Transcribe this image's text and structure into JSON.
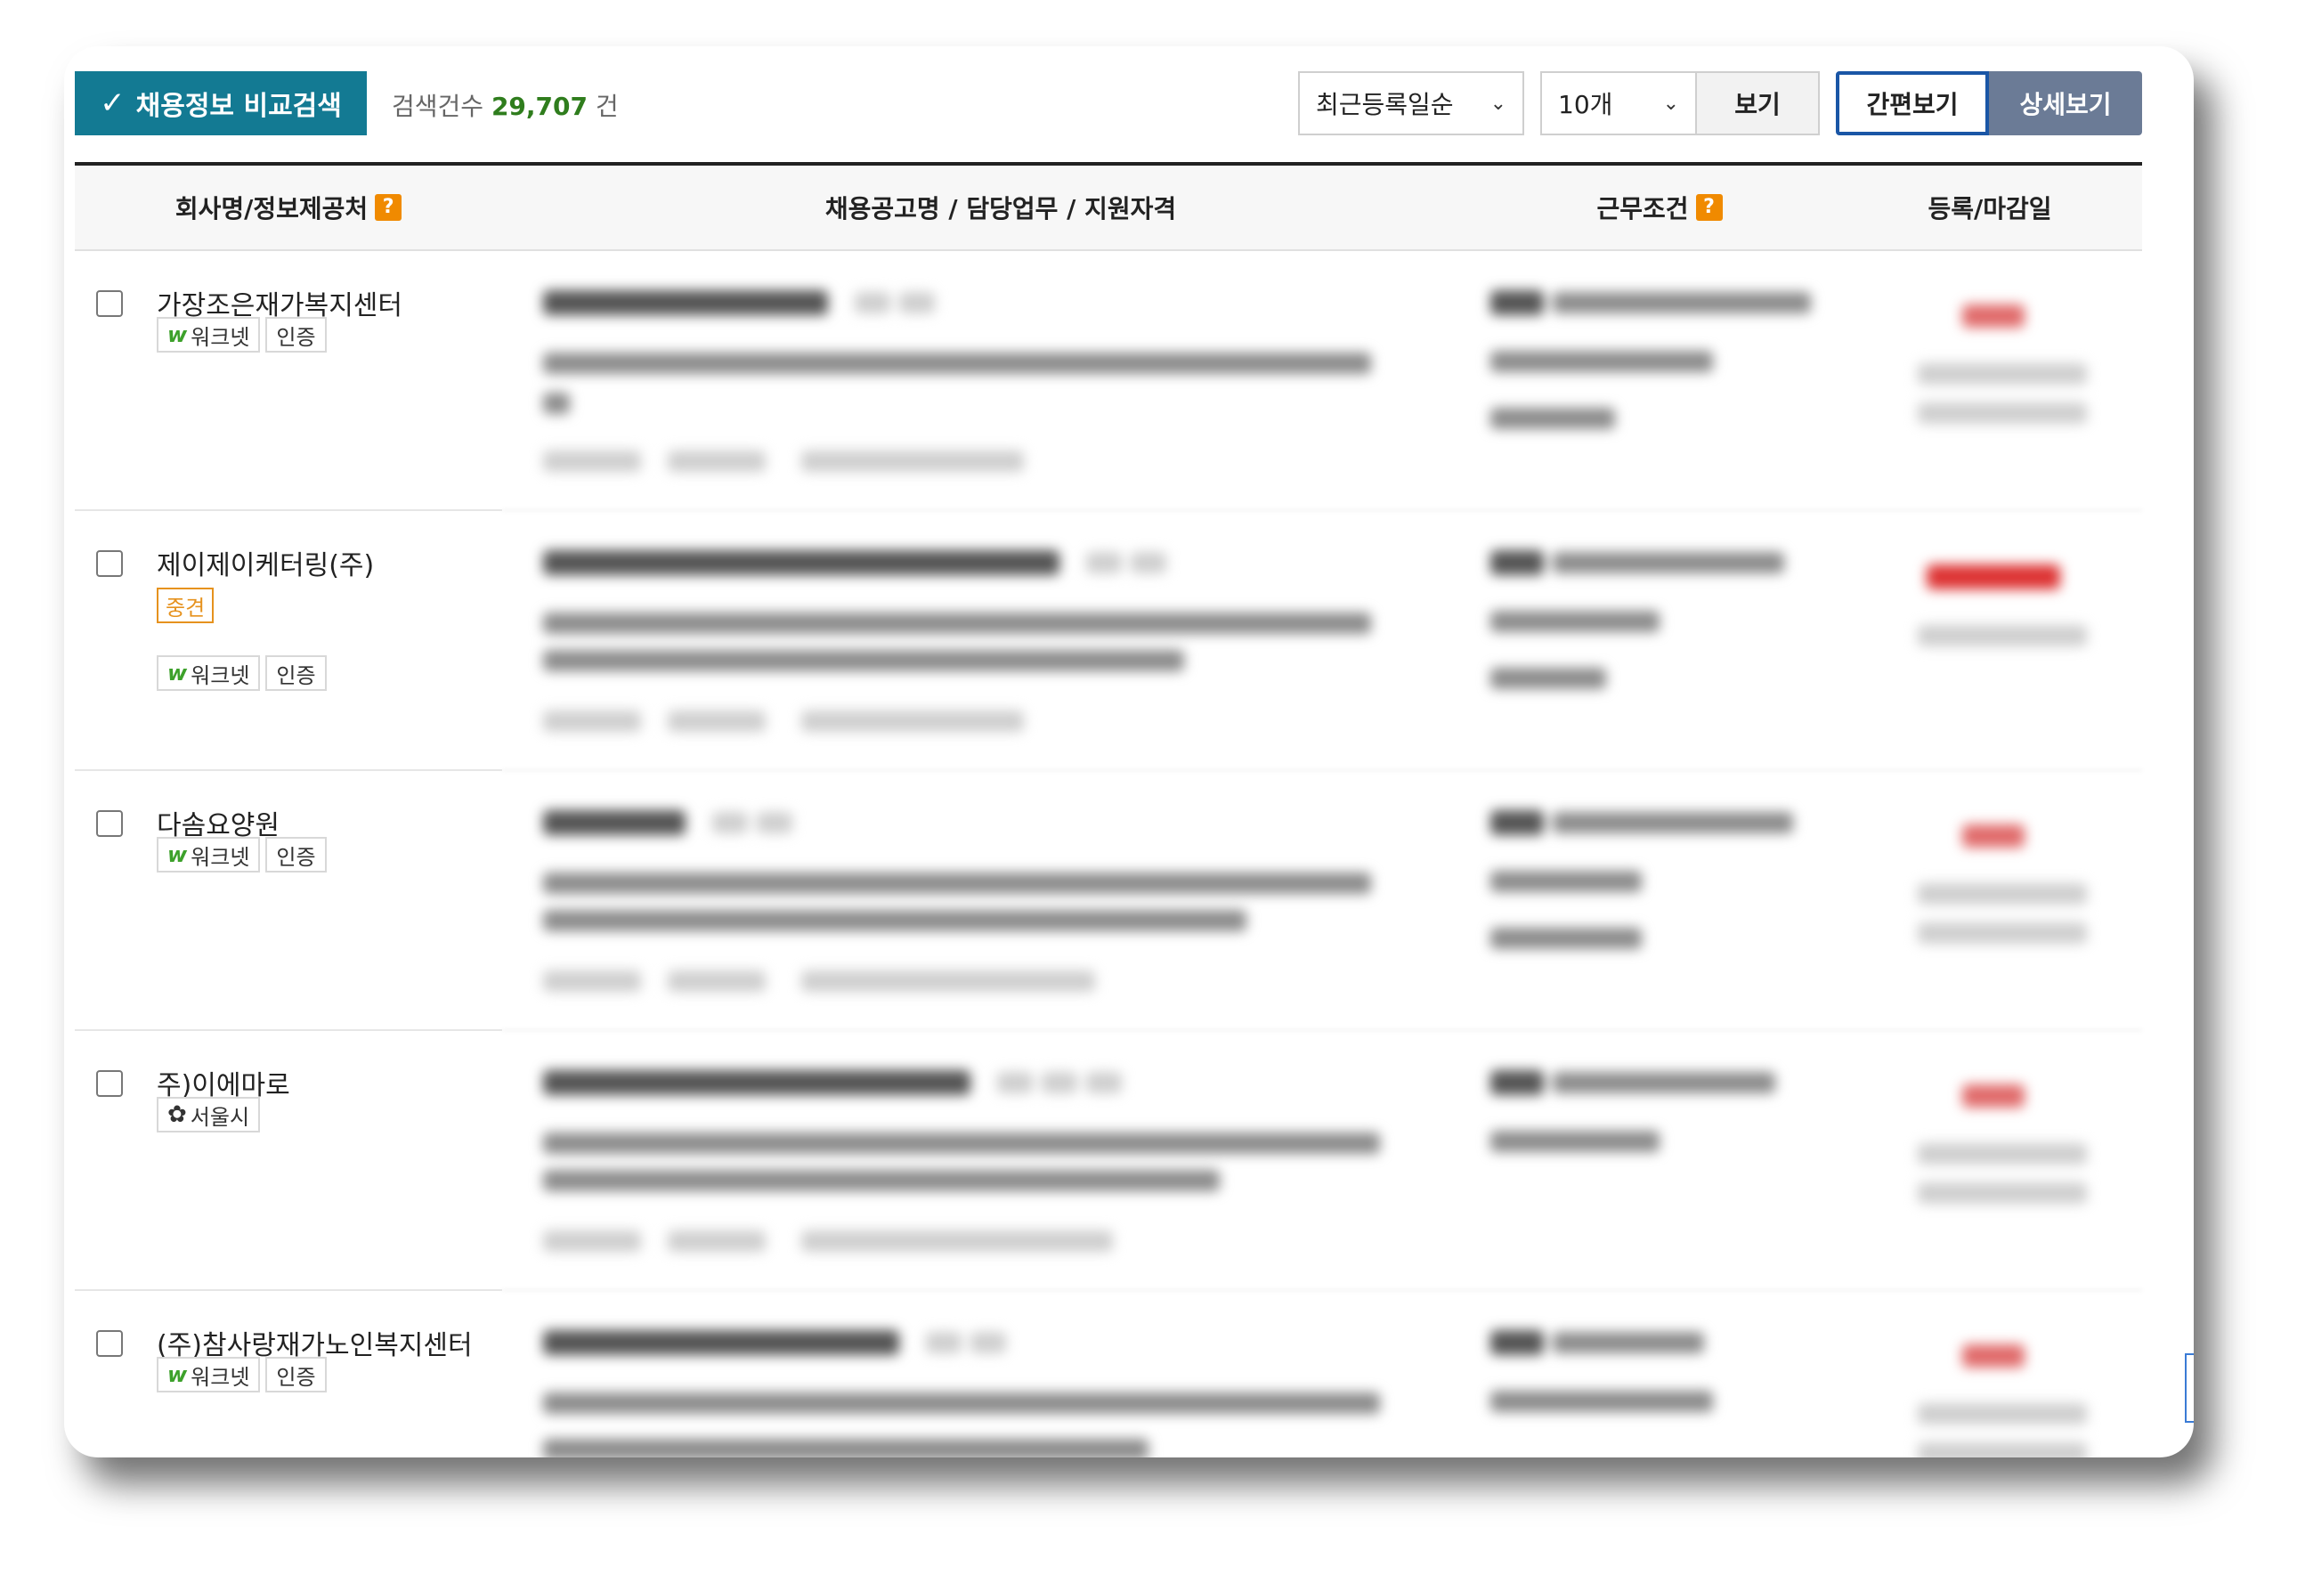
{
  "toolbar": {
    "compare_label": "채용정보 비교검색",
    "count_prefix": "검색건수",
    "count_value": "29,707",
    "count_suffix": "건",
    "sort_selected": "최근등록일순",
    "page_size_selected": "10개",
    "view_label": "보기",
    "simple_view_label": "간편보기",
    "detail_view_label": "상세보기"
  },
  "table": {
    "headers": {
      "company": "회사명/정보제공처",
      "posting": "채용공고명 / 담당업무 / 지원자격",
      "conditions": "근무조건",
      "dates": "등록/마감일"
    },
    "help_mark": "?"
  },
  "rows": [
    {
      "company": "가장조은재가복지센터",
      "tag": "",
      "badges": [
        "워크넷",
        "인증"
      ]
    },
    {
      "company": "제이제이케터링(주)",
      "tag": "중견",
      "badges": [
        "워크넷",
        "인증"
      ]
    },
    {
      "company": "다솜요양원",
      "tag": "",
      "badges": [
        "워크넷",
        "인증"
      ]
    },
    {
      "company": "주)이에마로",
      "tag": "",
      "badges": [
        "서울시"
      ]
    },
    {
      "company": "(주)참사랑재가노인복지센터",
      "tag": "",
      "badges": [
        "워크넷",
        "인증"
      ]
    }
  ],
  "colors": {
    "compare_button": "#137a93",
    "count_value": "#2f7d1d",
    "help_mark": "#f08a00",
    "detail_view": "#6b7b96",
    "simple_view_border": "#1a56a6",
    "tag": "#e6921e"
  },
  "icons": {
    "compare": "check-icon",
    "select_caret": "chevron-down-icon",
    "worknet": "worknet-logo-icon",
    "seoul": "seoul-logo-icon"
  }
}
